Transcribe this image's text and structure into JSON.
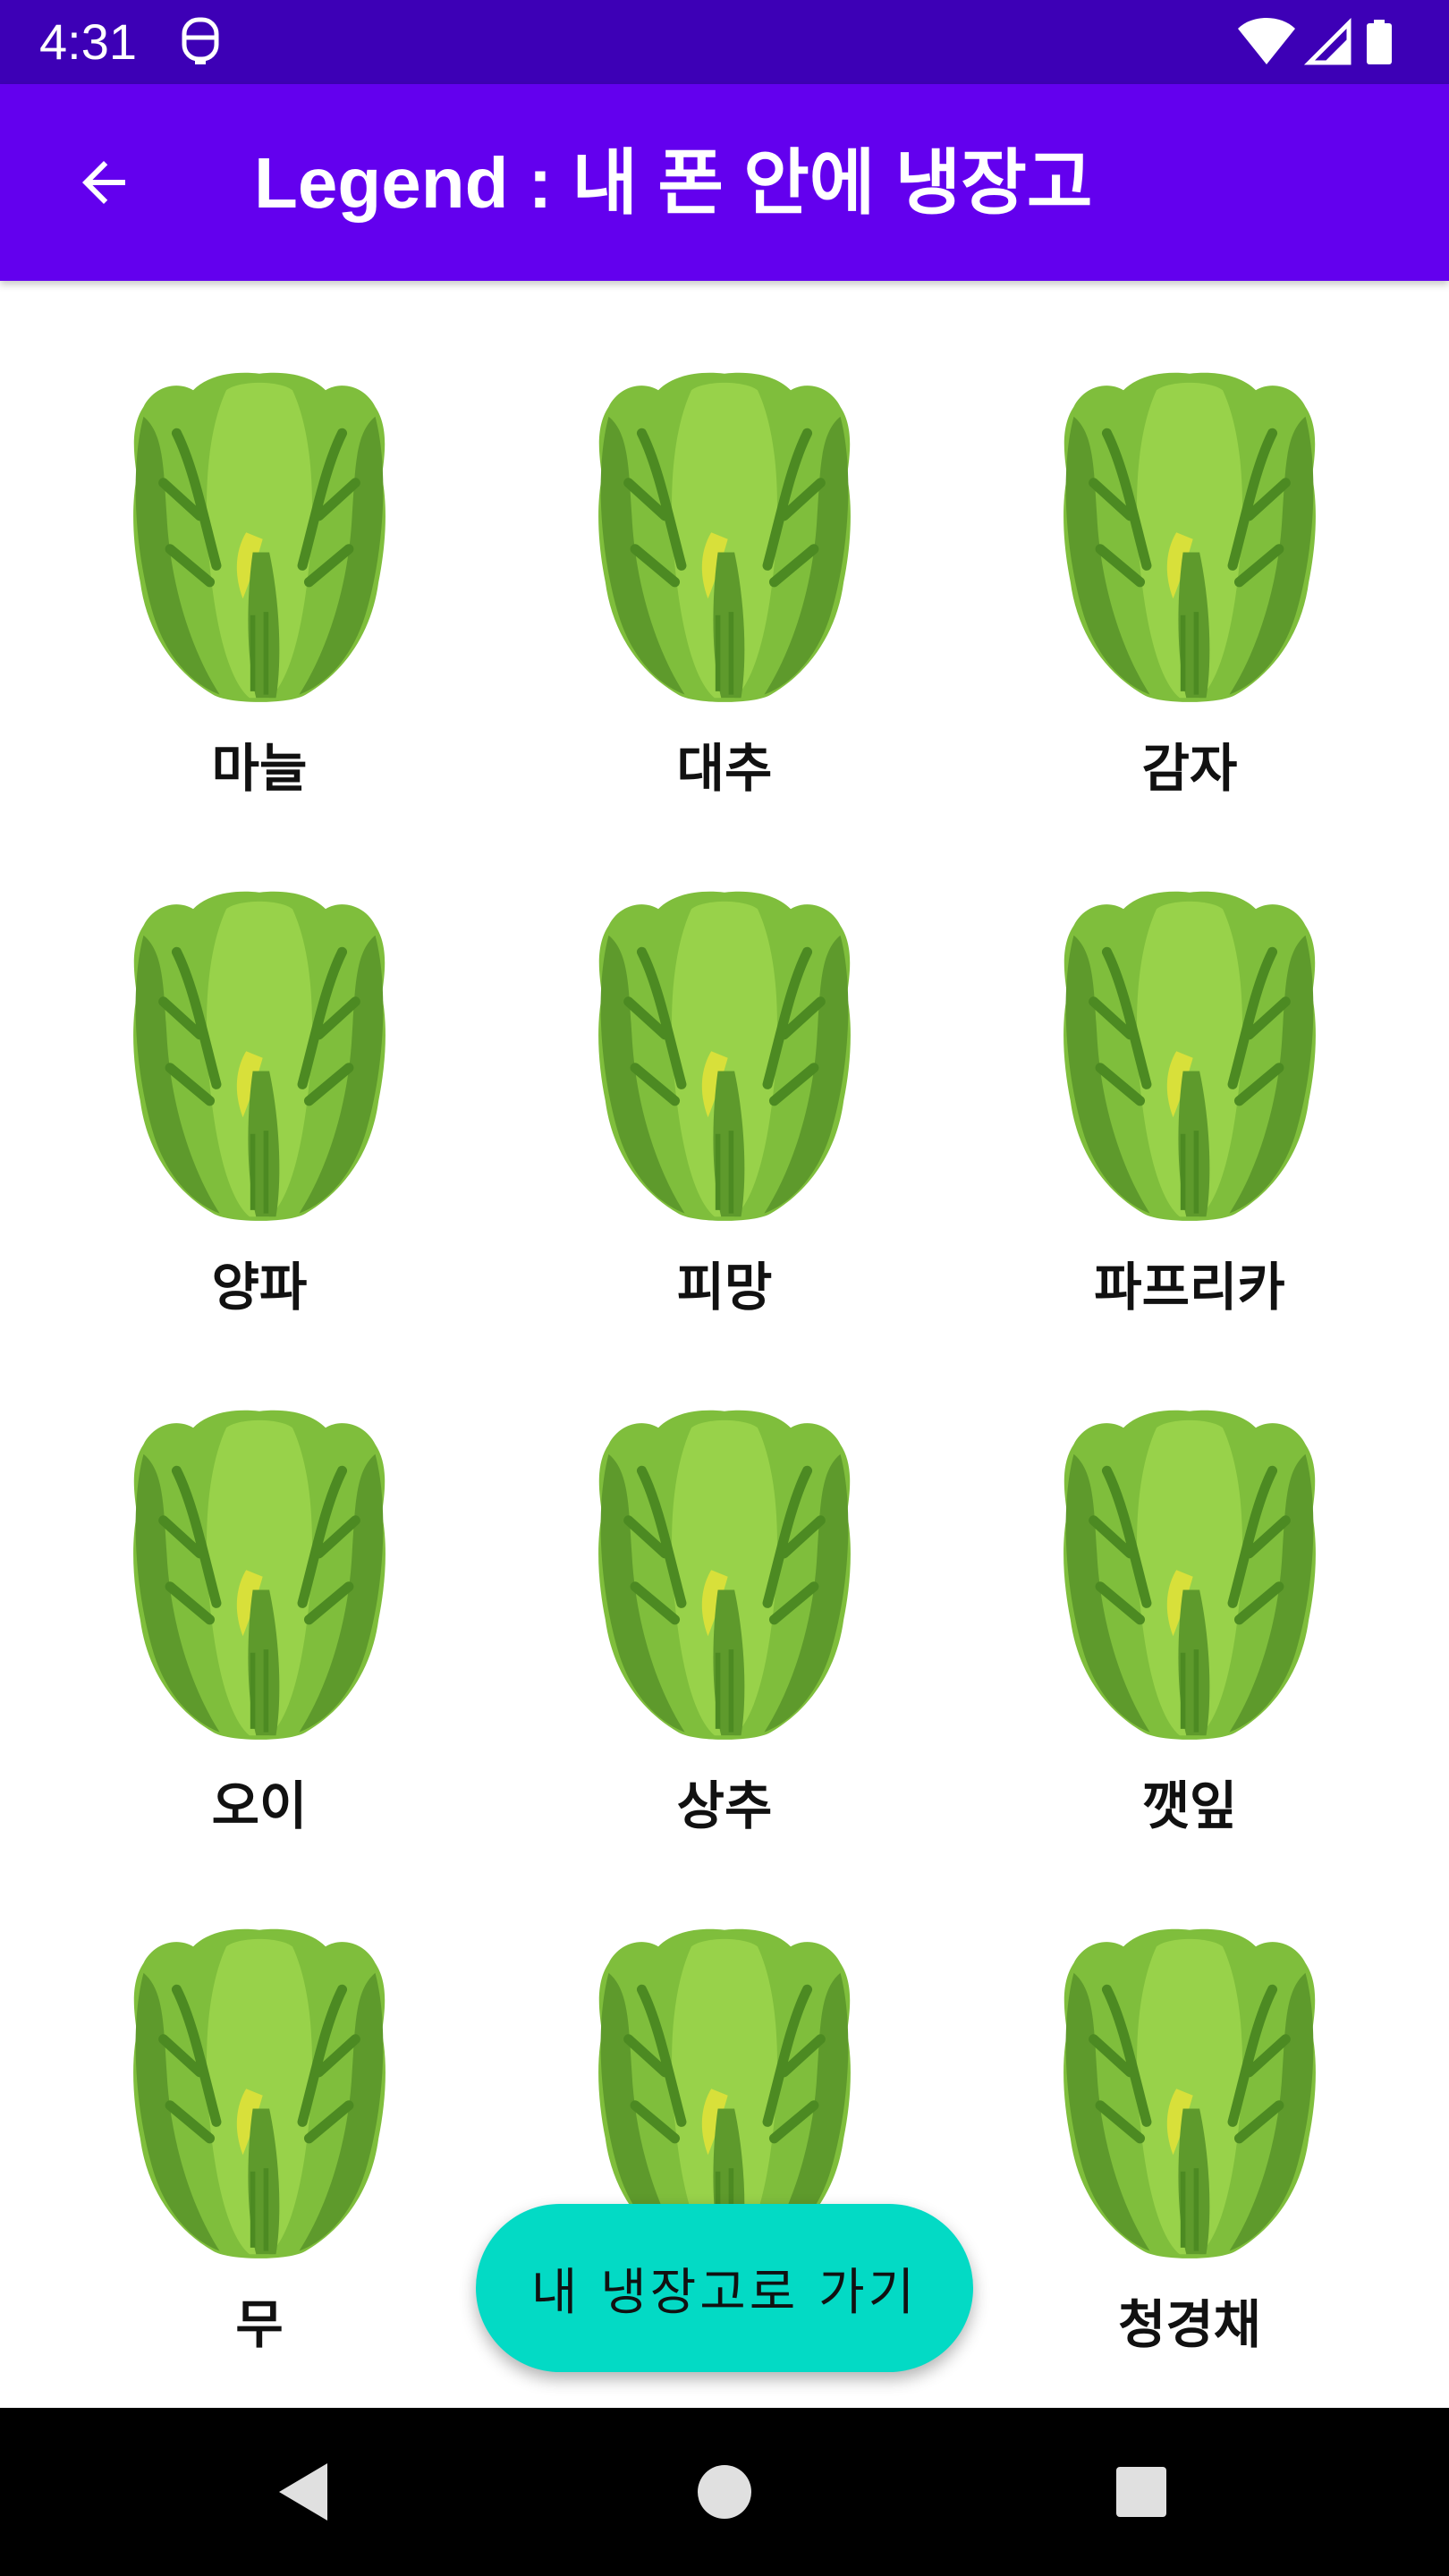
{
  "status_bar": {
    "time": "4:31",
    "icons": [
      "notification-icon",
      "wifi-icon",
      "signal-icon",
      "battery-icon"
    ]
  },
  "app_bar": {
    "title": "Legend : 내 폰 안에 냉장고",
    "back_icon": "arrow-left-icon",
    "color": "#6300ee"
  },
  "grid": {
    "items": [
      {
        "label": "마늘"
      },
      {
        "label": "대추"
      },
      {
        "label": "감자"
      },
      {
        "label": "양파"
      },
      {
        "label": "피망"
      },
      {
        "label": "파프리카"
      },
      {
        "label": "오이"
      },
      {
        "label": "상추"
      },
      {
        "label": "깻잎"
      },
      {
        "label": "무"
      },
      {
        "label": ""
      },
      {
        "label": "청경채"
      }
    ],
    "item_icon": "lettuce-icon"
  },
  "fab": {
    "label": "내 냉장고로 가기",
    "color": "#03dac5"
  },
  "nav_bar": {
    "icons": [
      "back-triangle-icon",
      "home-circle-icon",
      "recents-square-icon"
    ]
  }
}
